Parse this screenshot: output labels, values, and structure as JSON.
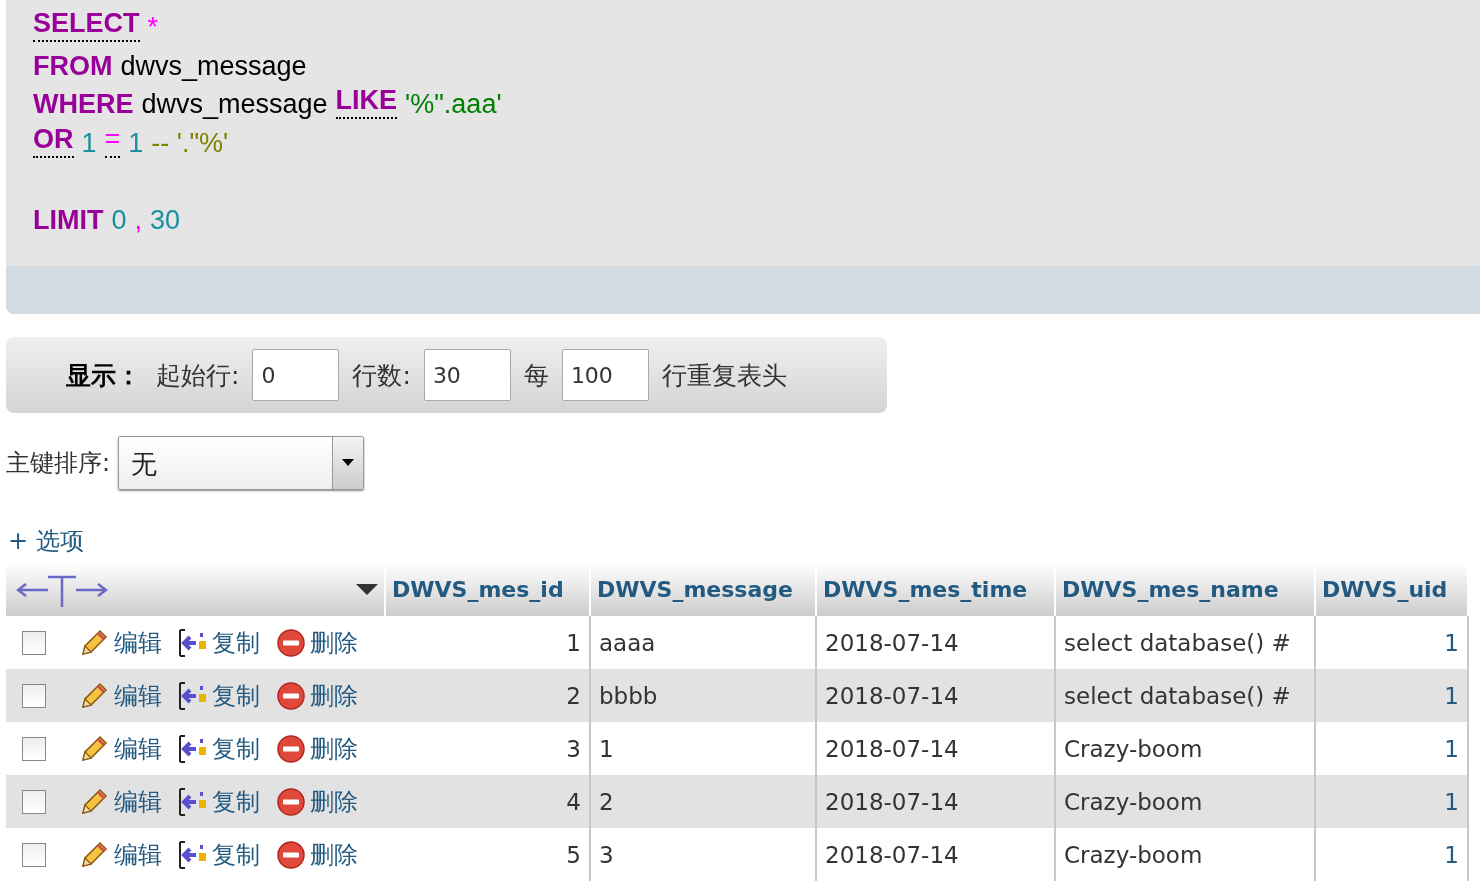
{
  "sql_editor": {
    "lines": [
      {
        "blank_before": false,
        "tokens": [
          {
            "kind": "keyword",
            "text": "SELECT",
            "linked": true
          },
          {
            "kind": "operator",
            "text": "*",
            "linked": false
          }
        ]
      },
      {
        "blank_before": false,
        "tokens": [
          {
            "kind": "keyword",
            "text": "FROM",
            "linked": false
          },
          {
            "kind": "identifier",
            "text": "dwvs_message",
            "linked": false
          }
        ]
      },
      {
        "blank_before": false,
        "tokens": [
          {
            "kind": "keyword",
            "text": "WHERE",
            "linked": false
          },
          {
            "kind": "identifier",
            "text": "dwvs_message",
            "linked": false
          },
          {
            "kind": "keyword",
            "text": "LIKE",
            "linked": true
          },
          {
            "kind": "string",
            "text": "'%\".aaa'",
            "linked": false
          }
        ]
      },
      {
        "blank_before": false,
        "tokens": [
          {
            "kind": "keyword",
            "text": "OR",
            "linked": true
          },
          {
            "kind": "number",
            "text": "1",
            "linked": false
          },
          {
            "kind": "operator",
            "text": "=",
            "linked": true
          },
          {
            "kind": "number",
            "text": "1",
            "linked": false
          },
          {
            "kind": "comment",
            "text": "-- '.\"%'",
            "linked": false
          }
        ]
      },
      {
        "blank_before": true,
        "tokens": [
          {
            "kind": "keyword",
            "text": "LIMIT",
            "linked": false
          },
          {
            "kind": "number",
            "text": "0",
            "linked": false
          },
          {
            "kind": "operator",
            "text": ",",
            "linked": false
          },
          {
            "kind": "number",
            "text": "30",
            "linked": false
          }
        ]
      }
    ]
  },
  "display_bar": {
    "label": "显示：",
    "start_label": "起始行:",
    "start_value": "0",
    "rows_label": "行数:",
    "rows_value": "30",
    "every_label": "每",
    "every_value": "100",
    "repeat_label": "行重复表头"
  },
  "sort": {
    "label": "主键排序:",
    "value": "无"
  },
  "options_link": "+ 选项",
  "table": {
    "columns": [
      "DWVS_mes_id",
      "DWVS_message",
      "DWVS_mes_time",
      "DWVS_mes_name",
      "DWVS_uid"
    ],
    "rows": [
      {
        "checked": false,
        "actions": [
          {
            "kind": "edit",
            "label": "编辑"
          },
          {
            "kind": "copy",
            "label": "复制"
          },
          {
            "kind": "delete",
            "label": "删除"
          }
        ],
        "cells": [
          "1",
          "aaaa",
          "2018-07-14",
          "select database()  #",
          "1"
        ]
      },
      {
        "checked": false,
        "actions": [
          {
            "kind": "edit",
            "label": "编辑"
          },
          {
            "kind": "copy",
            "label": "复制"
          },
          {
            "kind": "delete",
            "label": "删除"
          }
        ],
        "cells": [
          "2",
          "bbbb",
          "2018-07-14",
          "select database()  #",
          "1"
        ]
      },
      {
        "checked": false,
        "actions": [
          {
            "kind": "edit",
            "label": "编辑"
          },
          {
            "kind": "copy",
            "label": "复制"
          },
          {
            "kind": "delete",
            "label": "删除"
          }
        ],
        "cells": [
          "3",
          "1",
          "2018-07-14",
          "Crazy-boom",
          "1"
        ]
      },
      {
        "checked": false,
        "actions": [
          {
            "kind": "edit",
            "label": "编辑"
          },
          {
            "kind": "copy",
            "label": "复制"
          },
          {
            "kind": "delete",
            "label": "删除"
          }
        ],
        "cells": [
          "4",
          "2",
          "2018-07-14",
          "Crazy-boom",
          "1"
        ]
      },
      {
        "checked": false,
        "actions": [
          {
            "kind": "edit",
            "label": "编辑"
          },
          {
            "kind": "copy",
            "label": "复制"
          },
          {
            "kind": "delete",
            "label": "删除"
          }
        ],
        "cells": [
          "5",
          "3",
          "2018-07-14",
          "Crazy-boom",
          "1"
        ]
      }
    ]
  }
}
